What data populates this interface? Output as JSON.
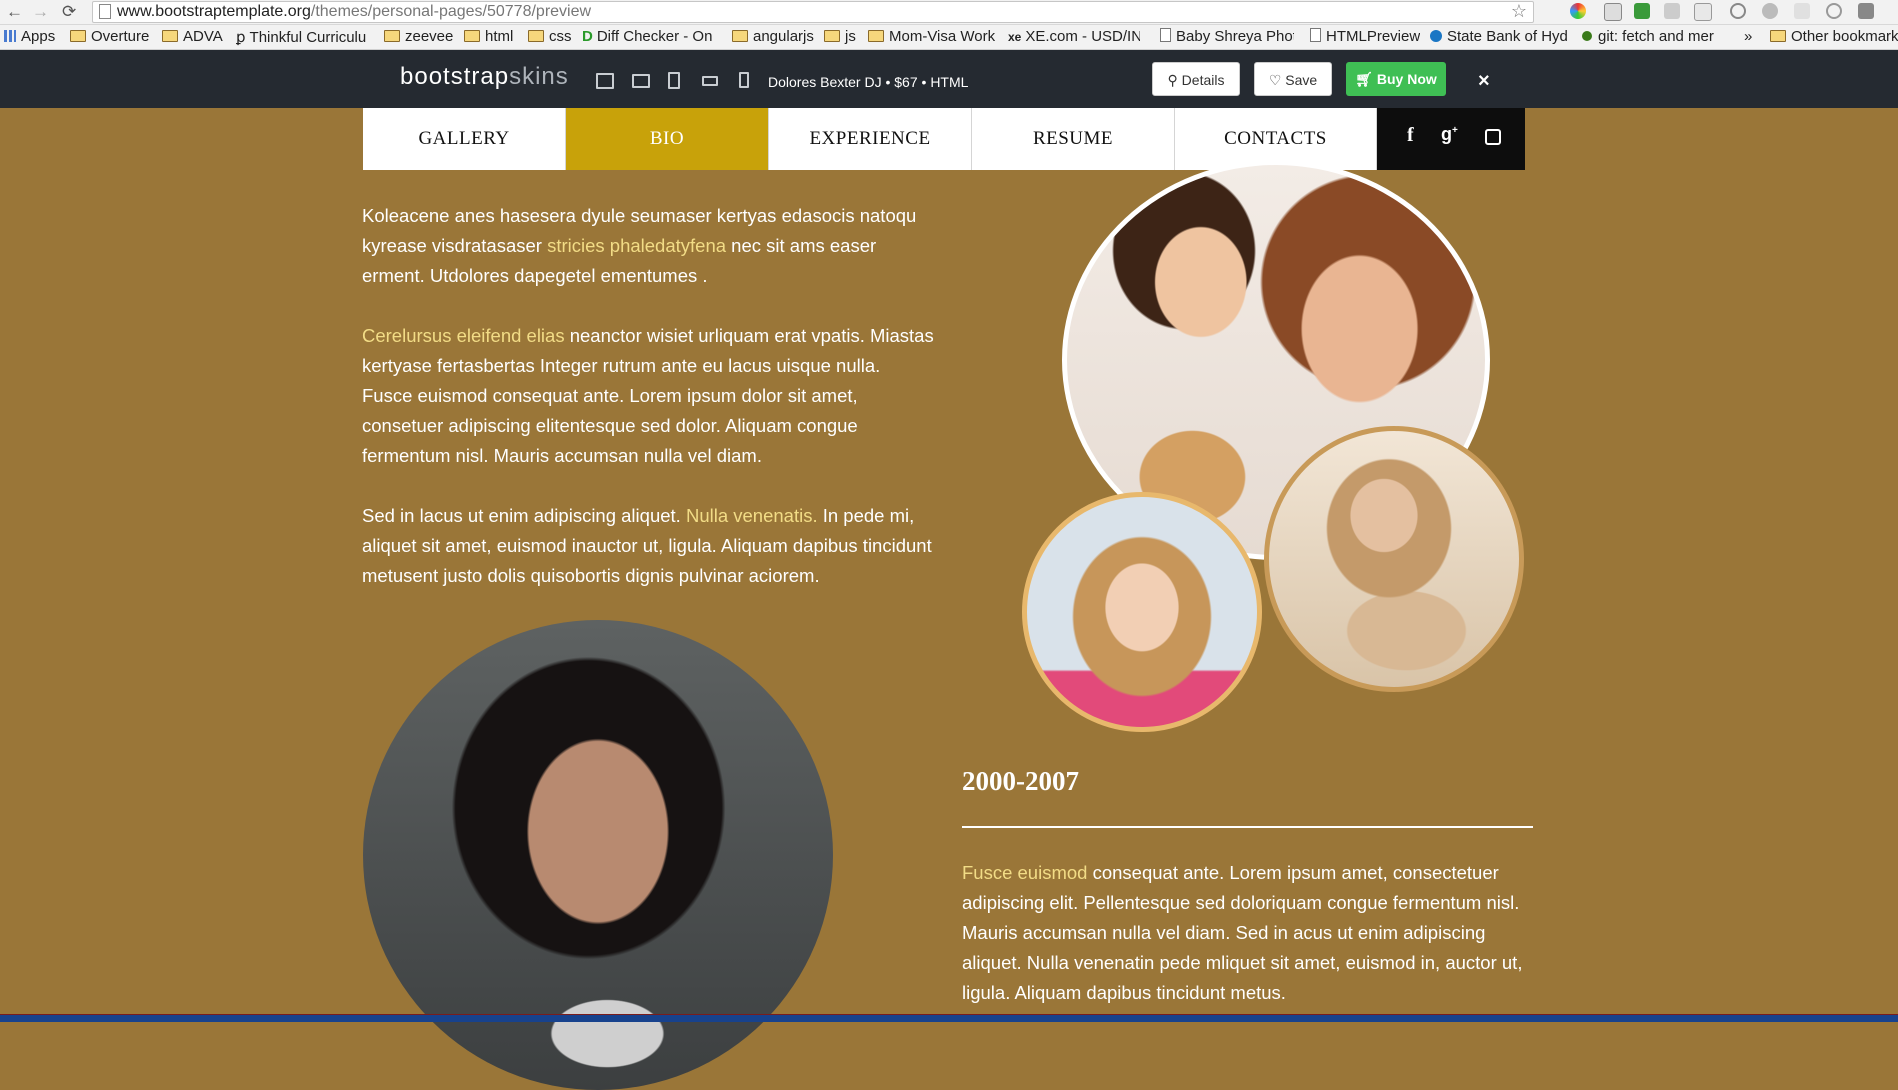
{
  "browser": {
    "url_host": "www.bootstraptemplate.org",
    "url_path": "/themes/personal-pages/50778/preview",
    "bookmarks": [
      {
        "label": "Apps",
        "type": "apps"
      },
      {
        "label": "Overture",
        "type": "folder"
      },
      {
        "label": "ADVA",
        "type": "folder"
      },
      {
        "label": "Thinkful Curriculu",
        "type": "link"
      },
      {
        "label": "zeevee",
        "type": "folder"
      },
      {
        "label": "html",
        "type": "folder"
      },
      {
        "label": "css",
        "type": "folder"
      },
      {
        "label": "Diff Checker - On",
        "type": "link"
      },
      {
        "label": "angularjs",
        "type": "folder"
      },
      {
        "label": "js",
        "type": "folder"
      },
      {
        "label": "Mom-Visa Work",
        "type": "folder"
      },
      {
        "label": "XE.com - USD/INR",
        "type": "link"
      },
      {
        "label": "Baby Shreya Phot",
        "type": "doc"
      },
      {
        "label": "HTMLPreview",
        "type": "doc"
      },
      {
        "label": "State Bank of Hyd",
        "type": "link"
      },
      {
        "label": "git: fetch and mer",
        "type": "link"
      },
      {
        "label": "»",
        "type": "more"
      },
      {
        "label": "Other bookmark",
        "type": "folder"
      }
    ]
  },
  "topbar": {
    "brand_main": "bootstrap",
    "brand_light": "skins",
    "theme_info": "Dolores Bexter DJ • $67 • HTML",
    "details_label": "Details",
    "save_label": "Save",
    "buy_label": "Buy Now",
    "close_label": "×"
  },
  "nav": {
    "items": [
      "GALLERY",
      "BIO",
      "EXPERIENCE",
      "RESUME",
      "CONTACTS"
    ],
    "active": "BIO",
    "social_icons": [
      "facebook-icon",
      "google-plus-icon",
      "twitter-icon"
    ]
  },
  "content": {
    "p1_a": "Koleacene anes hasesera dyule seumaser kertyas edasocis natoqu kyrease visdratasaser ",
    "p1_hl": "stricies phaledatyfena",
    "p1_b": " nec sit ams easer erment. Utdolores dapegetel ementumes .",
    "p2_hl": "Cerelursus eleifend elias",
    "p2_b": " neanctor wisiet urliquam erat vpatis. Miastas kertyase fertasbertas Integer rutrum ante eu lacus uisque nulla. Fusce euismod consequat ante. Lorem ipsum dolor sit amet, consetuer adipiscing elitentesque sed dolor. Aliquam congue fermentum nisl. Mauris accumsan nulla vel diam.",
    "p3_a": "Sed in lacus ut enim adipiscing aliquet. ",
    "p3_hl": "Nulla venenatis.",
    "p3_b": " In pede mi, aliquet sit amet, euismod inauctor ut, ligula. Aliquam dapibus tincidunt metusent justo dolis quisobortis dignis pulvinar aciorem.",
    "years": "2000-2007",
    "p4_hl": "Fusce euismod",
    "p4_b": " consequat ante. Lorem ipsum amet, consectetuer adipiscing elit. Pellentesque sed doloriquam congue fermentum nisl. Mauris accumsan nulla vel diam. Sed in acus ut enim adipiscing aliquet. Nulla venenatin pede mliquet sit amet, euismod in, auctor ut, ligula. Aliquam dapibus tincidunt metus."
  },
  "colors": {
    "page_bg": "#9a7638",
    "accent": "#c8a20a",
    "highlight_text": "#f2dc86",
    "topbar": "#252a31",
    "buy_button": "#3fbf54"
  }
}
